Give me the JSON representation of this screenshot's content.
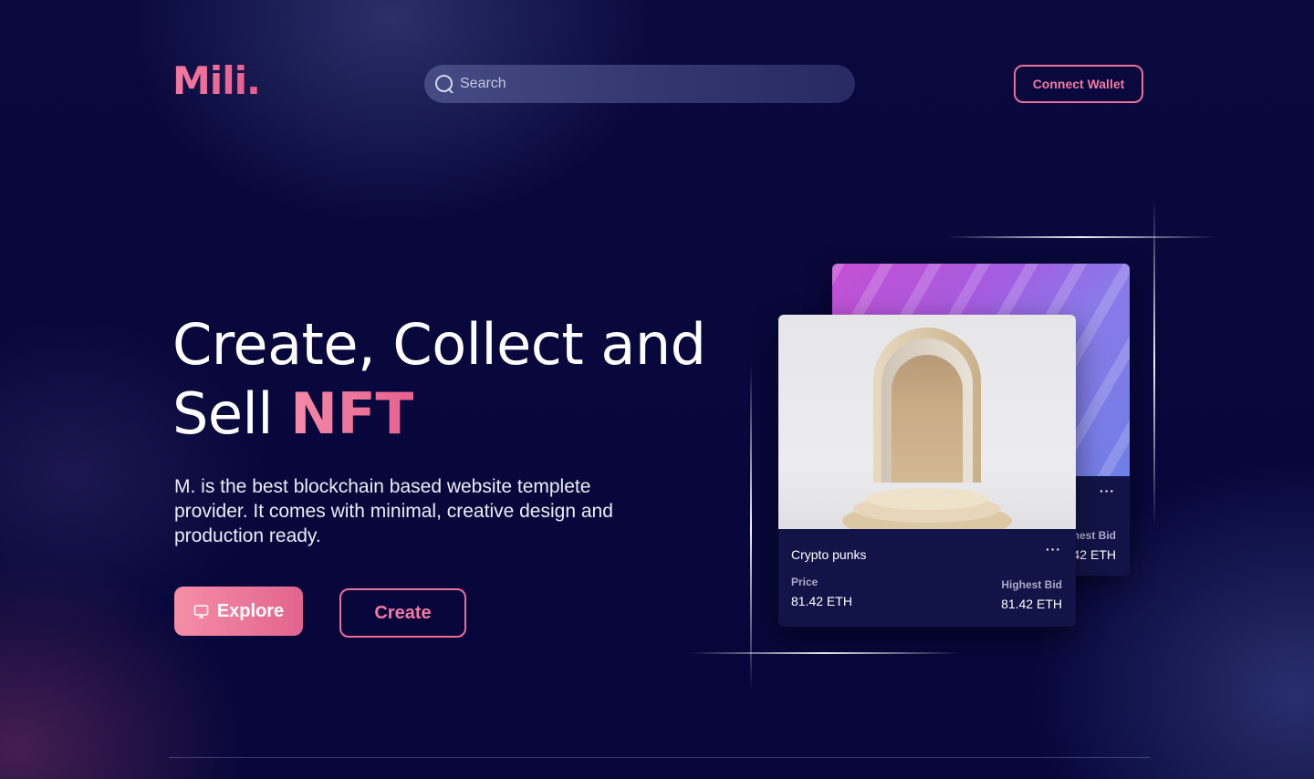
{
  "brand": {
    "logo": "Mili."
  },
  "search": {
    "placeholder": "Search"
  },
  "header": {
    "connect_wallet": "Connect Wallet"
  },
  "hero": {
    "title_line1": "Create, Collect and",
    "title_line2_prefix": "Sell ",
    "title_accent": "NFT",
    "description": "M. is the best blockchain based website templete provider. It comes with minimal, creative design and production ready.",
    "explore_label": "Explore",
    "create_label": "Create"
  },
  "cards": {
    "back": {
      "more": "···",
      "bid_label": "Highest Bid",
      "bid_value": "81.42 ETH"
    },
    "front": {
      "title": "Crypto punks",
      "more": "···",
      "price_label": "Price",
      "price_value": "81.42 ETH",
      "bid_label": "Highest Bid",
      "bid_value": "81.42 ETH"
    }
  },
  "colors": {
    "background": "#07073a",
    "accent": "#ef6e98",
    "card": "#121448"
  }
}
